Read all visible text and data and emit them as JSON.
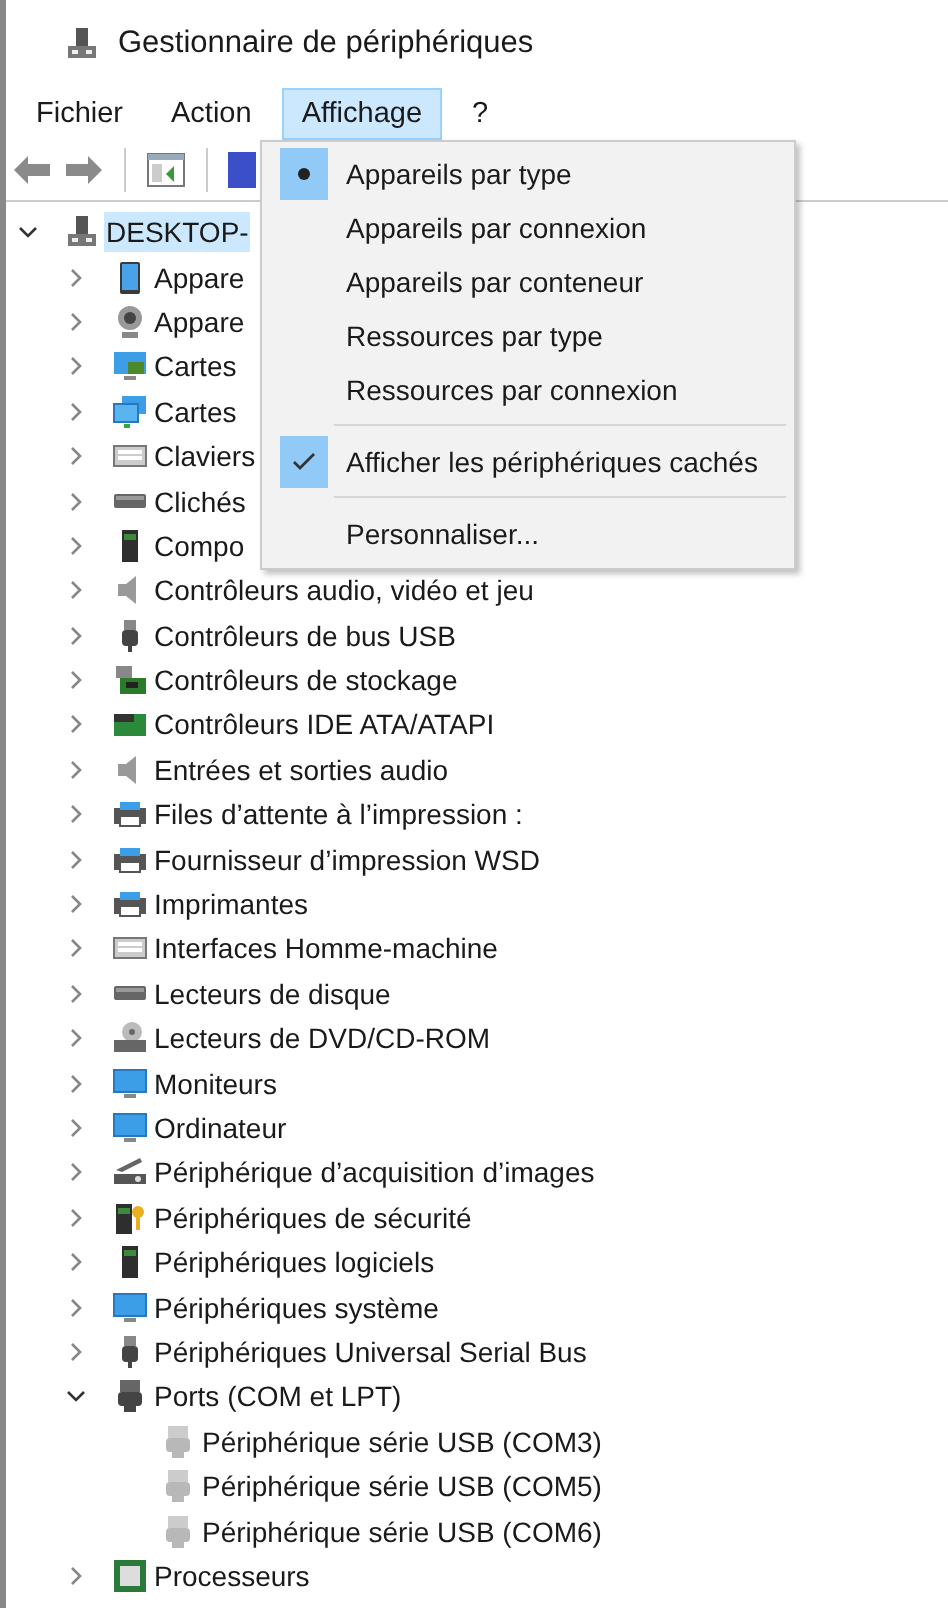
{
  "window": {
    "title": "Gestionnaire de périphériques"
  },
  "menubar": [
    {
      "label": "Fichier",
      "selected": false
    },
    {
      "label": "Action",
      "selected": false
    },
    {
      "label": "Affichage",
      "selected": true
    },
    {
      "label": "?",
      "selected": false
    }
  ],
  "tree": [
    {
      "label": "DESKTOP-",
      "kind": "computer",
      "expanded": true,
      "selected": true,
      "children": [
        {
          "label": "Appare",
          "kind": "tablet",
          "expanded": false,
          "selected": false
        },
        {
          "label": "Appare",
          "kind": "webcam",
          "expanded": false,
          "selected": false
        },
        {
          "label": "Cartes",
          "kind": "display",
          "expanded": false,
          "selected": false
        },
        {
          "label": "Cartes",
          "kind": "network",
          "expanded": false,
          "selected": false
        },
        {
          "label": "Claviers",
          "kind": "keyboard",
          "expanded": false,
          "selected": false
        },
        {
          "label": "Clichés",
          "kind": "storage",
          "expanded": false,
          "selected": false
        },
        {
          "label": "Compo",
          "kind": "component",
          "expanded": false,
          "selected": false
        },
        {
          "label": "Contrôleurs audio, vidéo et jeu",
          "kind": "speaker",
          "expanded": false,
          "selected": false
        },
        {
          "label": "Contrôleurs de bus USB",
          "kind": "usb",
          "expanded": false,
          "selected": false
        },
        {
          "label": "Contrôleurs de stockage",
          "kind": "storagectl",
          "expanded": false,
          "selected": false
        },
        {
          "label": "Contrôleurs IDE ATA/ATAPI",
          "kind": "card",
          "expanded": false,
          "selected": false
        },
        {
          "label": "Entrées et sorties audio",
          "kind": "speaker",
          "expanded": false,
          "selected": false
        },
        {
          "label": "Files d’attente à l’impression :",
          "kind": "printer",
          "expanded": false,
          "selected": false
        },
        {
          "label": "Fournisseur d’impression WSD",
          "kind": "printer",
          "expanded": false,
          "selected": false
        },
        {
          "label": "Imprimantes",
          "kind": "printer",
          "expanded": false,
          "selected": false
        },
        {
          "label": "Interfaces Homme-machine",
          "kind": "hid",
          "expanded": false,
          "selected": false
        },
        {
          "label": "Lecteurs de disque",
          "kind": "drive",
          "expanded": false,
          "selected": false
        },
        {
          "label": "Lecteurs de DVD/CD-ROM",
          "kind": "disc",
          "expanded": false,
          "selected": false
        },
        {
          "label": "Moniteurs",
          "kind": "monitor",
          "expanded": false,
          "selected": false
        },
        {
          "label": "Ordinateur",
          "kind": "monitor",
          "expanded": false,
          "selected": false
        },
        {
          "label": "Périphérique d’acquisition d’images",
          "kind": "scanner",
          "expanded": false,
          "selected": false
        },
        {
          "label": "Périphériques de sécurité",
          "kind": "security",
          "expanded": false,
          "selected": false
        },
        {
          "label": "Périphériques logiciels",
          "kind": "software",
          "expanded": false,
          "selected": false
        },
        {
          "label": "Périphériques système",
          "kind": "system",
          "expanded": false,
          "selected": false
        },
        {
          "label": "Périphériques Universal Serial Bus",
          "kind": "usb",
          "expanded": false,
          "selected": false
        },
        {
          "label": "Ports (COM et LPT)",
          "kind": "port",
          "expanded": true,
          "selected": false,
          "children": [
            {
              "label": "Périphérique série USB (COM3)",
              "kind": "portgrey",
              "selected": false
            },
            {
              "label": "Périphérique série USB (COM5)",
              "kind": "portgrey",
              "selected": false
            },
            {
              "label": "Périphérique série USB (COM6)",
              "kind": "portgrey",
              "selected": false
            }
          ]
        },
        {
          "label": "Processeurs",
          "kind": "chip",
          "expanded": false,
          "selected": false
        }
      ]
    }
  ],
  "menu": [
    {
      "kind": "radio",
      "label": "Appareils par type",
      "selected": true
    },
    {
      "kind": "radio",
      "label": "Appareils par connexion",
      "selected": false
    },
    {
      "kind": "radio",
      "label": "Appareils par conteneur",
      "selected": false
    },
    {
      "kind": "radio",
      "label": "Ressources par type",
      "selected": false
    },
    {
      "kind": "radio",
      "label": "Ressources par connexion",
      "selected": false
    },
    {
      "kind": "separator"
    },
    {
      "kind": "check",
      "label": "Afficher les périphériques cachés",
      "checked": true
    },
    {
      "kind": "separator"
    },
    {
      "kind": "command",
      "label": "Personnaliser..."
    }
  ]
}
